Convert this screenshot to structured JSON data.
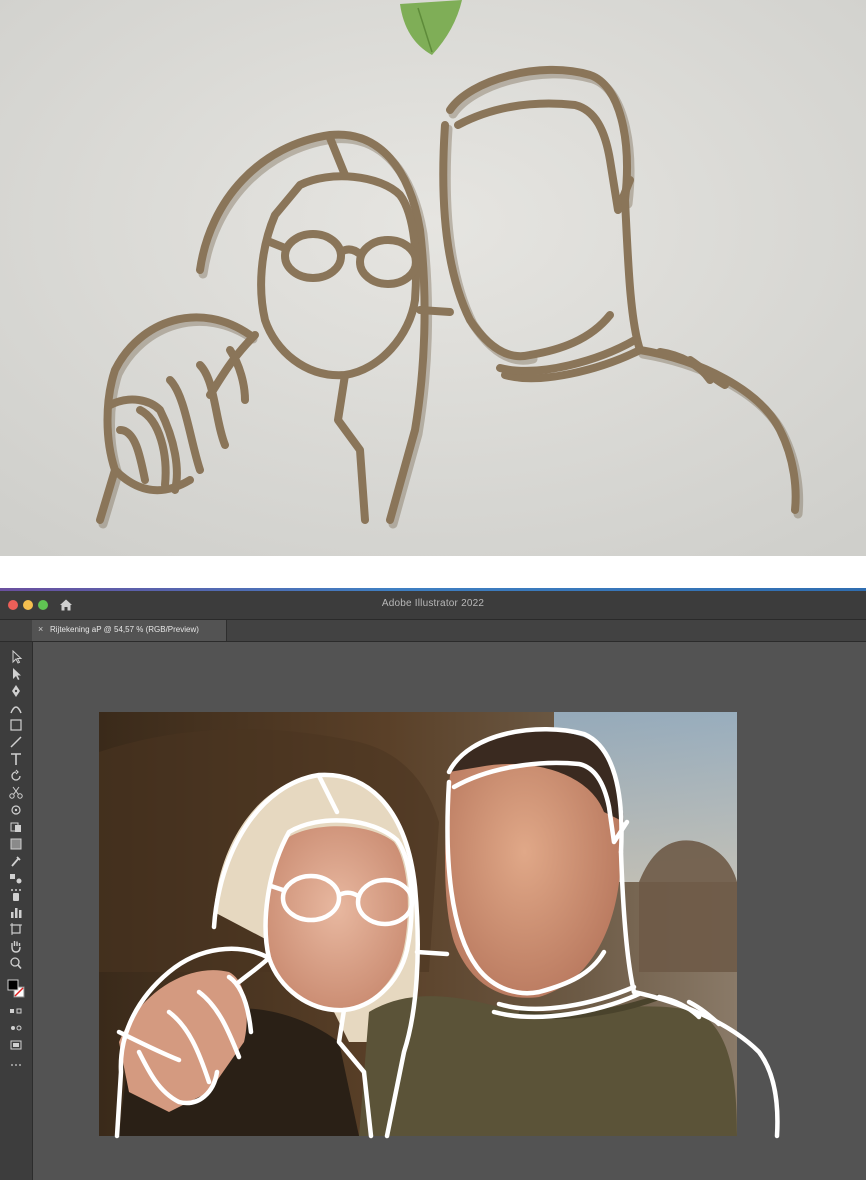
{
  "window": {
    "app_title": "Adobe Illustrator 2022",
    "tab_label": "Rijtekening aP @ 54,57 % (RGB/Preview)",
    "tab_close_glyph": "×",
    "traffic_lights": {
      "close": "#ed5f58",
      "minimize": "#f5bf4f",
      "maximize": "#60c453"
    }
  },
  "toolbar": {
    "tools": [
      "selection-tool-icon",
      "direct-selection-tool-icon",
      "pen-tool-icon",
      "curvature-tool-icon",
      "rectangle-tool-icon",
      "line-tool-icon",
      "type-tool-icon",
      "rotate-tool-icon",
      "scissors-tool-icon",
      "width-tool-icon",
      "shape-builder-tool-icon",
      "gradient-tool-icon",
      "eyedropper-tool-icon",
      "blend-tool-icon",
      "symbol-sprayer-tool-icon",
      "graph-tool-icon",
      "artboard-tool-icon",
      "hand-tool-icon",
      "zoom-tool-icon"
    ],
    "fill_color": "#000000",
    "stroke_color": "#ffffff"
  },
  "colors": {
    "wall": "#dcdcd8",
    "wood_outline": "#8a7559",
    "trace_stroke": "#ffffff",
    "canvas": "#535353",
    "panel": "#3c3c3c"
  },
  "icons": {
    "home": "home-icon",
    "leaf": "leaf-icon"
  }
}
